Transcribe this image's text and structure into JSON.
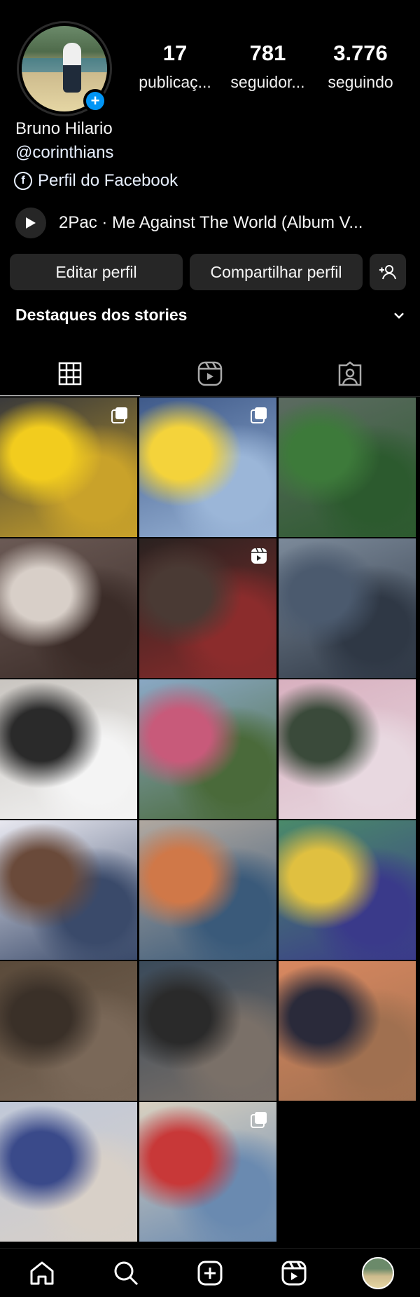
{
  "profile": {
    "name": "Bruno Hilario",
    "handle": "@corinthians",
    "facebook_link": "Perfil do Facebook",
    "add_badge": "+",
    "stats": [
      {
        "value": "17",
        "label": "publicaç..."
      },
      {
        "value": "781",
        "label": "seguidor..."
      },
      {
        "value": "3.776",
        "label": "seguindo"
      }
    ],
    "music_track": "2Pac · Me Against The World (Album V..."
  },
  "actions": {
    "edit_label": "Editar perfil",
    "share_label": "Compartilhar perfil"
  },
  "highlights": {
    "title": "Destaques dos stories"
  },
  "tabs": [
    {
      "icon": "grid-icon",
      "active": true
    },
    {
      "icon": "reels-icon",
      "active": false
    },
    {
      "icon": "tagged-icon",
      "active": false
    }
  ],
  "posts": [
    {
      "marker": "carousel",
      "colors": [
        "#3a3a3a",
        "#f2cc1e",
        "#c9a22a"
      ]
    },
    {
      "marker": "carousel",
      "colors": [
        "#3f5a8a",
        "#f4d33b",
        "#9bb6d8"
      ]
    },
    {
      "marker": "",
      "colors": [
        "#5c6b61",
        "#3d7a3a",
        "#2c5a2e"
      ]
    },
    {
      "marker": "",
      "colors": [
        "#6b5a55",
        "#d8cfc8",
        "#3b2c28"
      ]
    },
    {
      "marker": "reel",
      "colors": [
        "#2a2220",
        "#4a3a34",
        "#8b2c2c"
      ]
    },
    {
      "marker": "",
      "colors": [
        "#7c8a9a",
        "#4b5a6e",
        "#2f3845"
      ]
    },
    {
      "marker": "",
      "colors": [
        "#c9c5c0",
        "#2a2a2a",
        "#f4f4f4"
      ]
    },
    {
      "marker": "",
      "colors": [
        "#8aa8c4",
        "#c85a7a",
        "#4a6a3a"
      ]
    },
    {
      "marker": "",
      "colors": [
        "#d8b0bf",
        "#3a4a3a",
        "#e8d8e0"
      ]
    },
    {
      "marker": "",
      "colors": [
        "#e8e8f0",
        "#6a4a3a",
        "#3a4a6a"
      ]
    },
    {
      "marker": "",
      "colors": [
        "#b0a8a0",
        "#d07848",
        "#3a5a7a"
      ]
    },
    {
      "marker": "",
      "colors": [
        "#4a8a6a",
        "#e0c040",
        "#3a3a8a"
      ]
    },
    {
      "marker": "",
      "colors": [
        "#5a4a3a",
        "#3a3028",
        "#7a6858"
      ]
    },
    {
      "marker": "",
      "colors": [
        "#3a4a5a",
        "#2a2a2a",
        "#7a7068"
      ]
    },
    {
      "marker": "",
      "colors": [
        "#d88860",
        "#2a2a3a",
        "#a07050"
      ]
    },
    {
      "marker": "",
      "colors": [
        "#c0c8d8",
        "#3a4a8a",
        "#d8d0c8"
      ]
    },
    {
      "marker": "carousel",
      "colors": [
        "#d8d0c0",
        "#c83838",
        "#6a8ab0"
      ]
    }
  ],
  "nav": [
    {
      "icon": "home-icon"
    },
    {
      "icon": "search-icon"
    },
    {
      "icon": "create-icon"
    },
    {
      "icon": "reels-icon"
    },
    {
      "icon": "profile-avatar"
    }
  ]
}
